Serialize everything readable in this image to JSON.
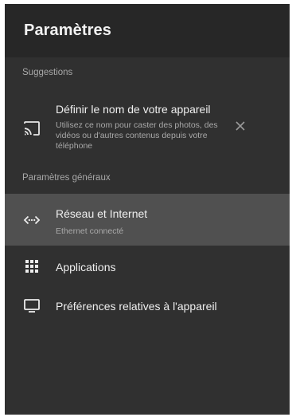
{
  "header": {
    "title": "Paramètres"
  },
  "suggestions": {
    "label": "Suggestions",
    "item": {
      "title": "Définir le nom de votre appareil",
      "subtitle_lines": [
        "Utilisez ce nom pour caster des photos, des",
        "vidéos ou d'autres contenus depuis votre",
        "téléphone"
      ],
      "icon": "cast-icon",
      "dismiss_icon": "close-icon"
    }
  },
  "general": {
    "label": "Paramètres généraux",
    "items": [
      {
        "title": "Réseau et Internet",
        "subtitle": "Ethernet connecté",
        "icon": "network-icon",
        "selected": true
      },
      {
        "title": "Applications",
        "icon": "apps-grid-icon"
      },
      {
        "title": "Préférences relatives à l'appareil",
        "icon": "tv-icon"
      }
    ]
  },
  "colors": {
    "background": "#303030",
    "header": "#272727",
    "selected": "#505050",
    "text_primary": "#efefef",
    "text_secondary": "#a8a8a8"
  }
}
